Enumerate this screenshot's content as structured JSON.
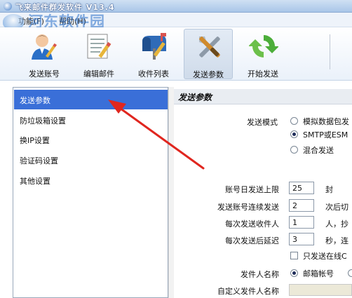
{
  "window": {
    "title": "飞来邮件群发软件  V13.4"
  },
  "menu": {
    "items": [
      "功能(F)",
      "帮助(H)"
    ]
  },
  "watermark": {
    "text": "河东软件园",
    "url": "www.pc0359.cn"
  },
  "toolbar": {
    "buttons": [
      {
        "label": "发送账号",
        "icon": "user-icon"
      },
      {
        "label": "编辑邮件",
        "icon": "edit-document-icon"
      },
      {
        "label": "收件列表",
        "icon": "mailbox-icon"
      },
      {
        "label": "发送参数",
        "icon": "tools-icon",
        "active": true
      },
      {
        "label": "开始发送",
        "icon": "refresh-icon"
      }
    ]
  },
  "nav": {
    "items": [
      "发送参数",
      "防垃圾箱设置",
      "换IP设置",
      "验证码设置",
      "其他设置"
    ],
    "selected_index": 0
  },
  "panel": {
    "title": "发送参数",
    "send_mode": {
      "label": "发送模式",
      "options": [
        "模拟数据包发",
        "SMTP或ESM",
        "混合发送"
      ],
      "selected_index": 1
    },
    "daily_limit": {
      "label": "账号日发送上限",
      "value": "25",
      "suffix": "封"
    },
    "consecutive": {
      "label": "发送账号连续发送",
      "value": "2",
      "suffix": "次后切"
    },
    "recipients_per": {
      "label": "每次发送收件人",
      "value": "1",
      "suffix": "人，抄"
    },
    "delay": {
      "label": "每次发送后延迟",
      "value": "3",
      "suffix": "秒，连"
    },
    "online_only": {
      "label": "只发送在线C",
      "checked": false
    },
    "sender_name": {
      "label": "发件人名称",
      "options": [
        "邮箱帐号",
        ""
      ],
      "selected_index": 0
    },
    "custom_sender_name": {
      "label": "自定义发件人名称",
      "value": ""
    }
  },
  "colors": {
    "selection": "#3a6fd8",
    "arrow": "#e0261f",
    "title_bar": "#a9c6e8"
  }
}
